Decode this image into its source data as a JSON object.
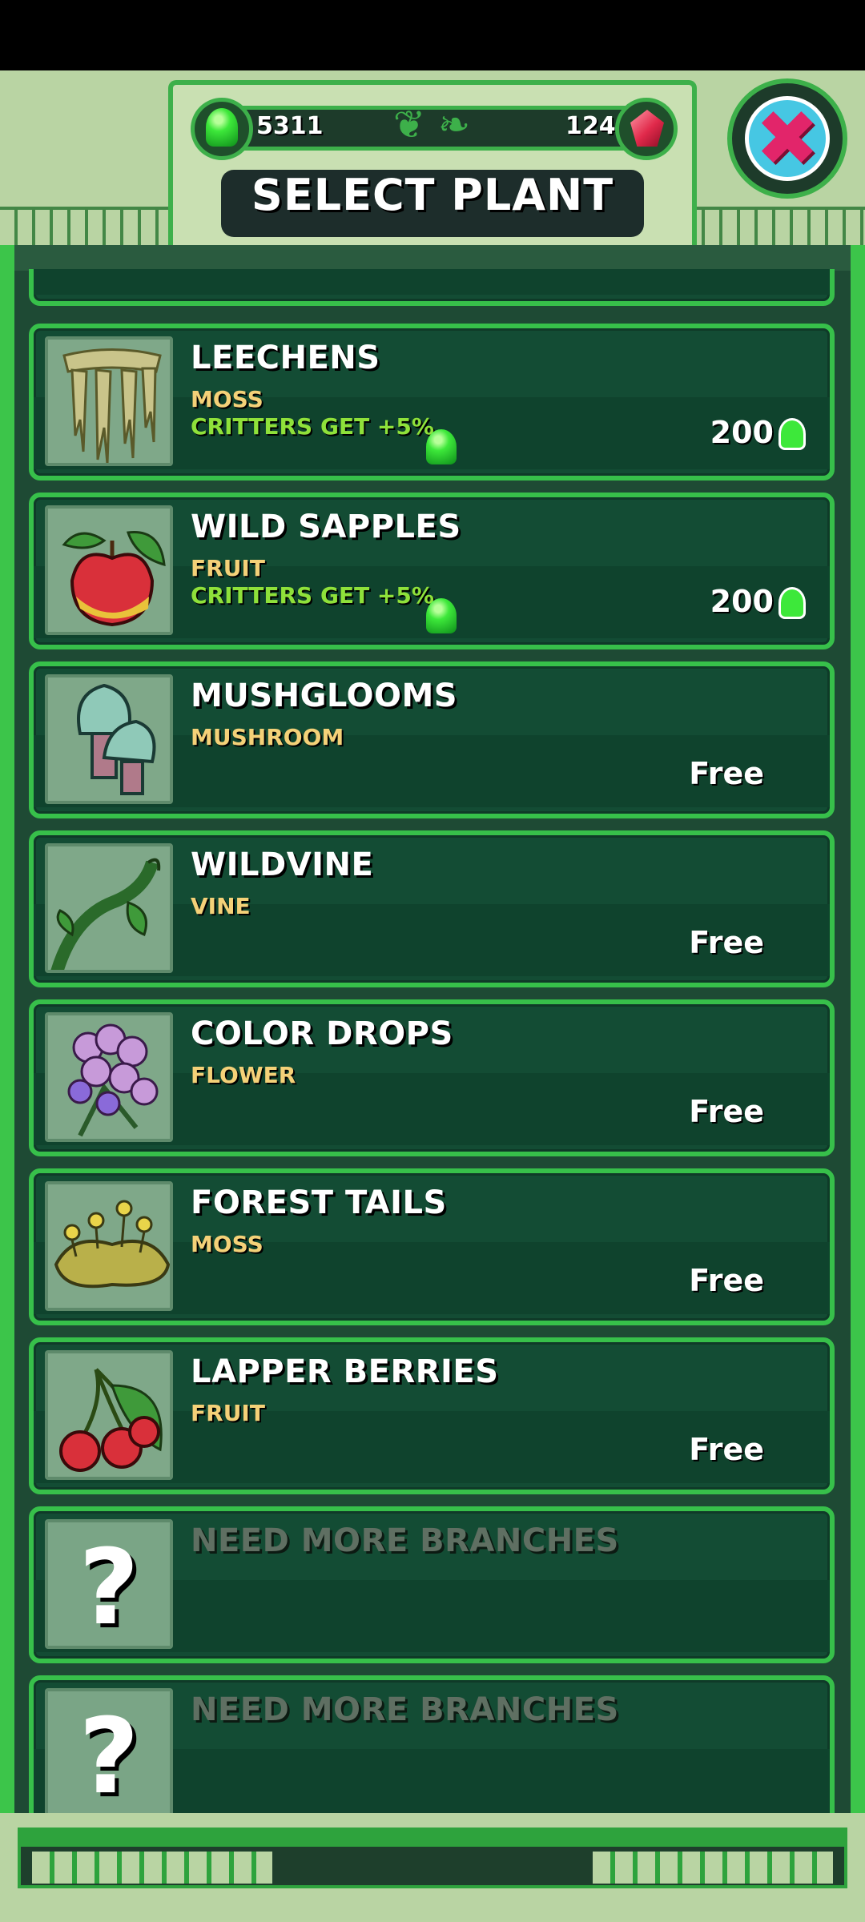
{
  "header": {
    "title": "SELECT PLANT",
    "seeds_count": "5311",
    "gems_count": "124",
    "close_icon": "close-x-icon"
  },
  "plants": [
    {
      "name": "LEECHENS",
      "type": "MOSS",
      "bonus": "CRITTERS GET +5%",
      "price": "200",
      "art": "hanging-moss-icon"
    },
    {
      "name": "WILD SAPPLES",
      "type": "FRUIT",
      "bonus": "CRITTERS GET +5%",
      "price": "200",
      "art": "apple-icon"
    },
    {
      "name": "MUSHGLOOMS",
      "type": "MUSHROOM",
      "price": "Free",
      "art": "mushroom-icon"
    },
    {
      "name": "WILDVINE",
      "type": "VINE",
      "price": "Free",
      "art": "vine-icon"
    },
    {
      "name": "COLOR DROPS",
      "type": "FLOWER",
      "price": "Free",
      "art": "flower-icon"
    },
    {
      "name": "FOREST TAILS",
      "type": "MOSS",
      "price": "Free",
      "art": "moss-patch-icon"
    },
    {
      "name": "LAPPER BERRIES",
      "type": "FRUIT",
      "price": "Free",
      "art": "cherries-icon"
    },
    {
      "name": "NEED MORE BRANCHES",
      "locked": true,
      "art": "question-mark-icon"
    },
    {
      "name": "NEED MORE BRANCHES",
      "locked": true,
      "art": "question-mark-icon"
    }
  ],
  "colors": {
    "panel": "#1e4a34",
    "card_border": "#37c04a",
    "type_text": "#f4d178",
    "bonus_text": "#8fe13a",
    "frame": "#b9d4a3"
  }
}
